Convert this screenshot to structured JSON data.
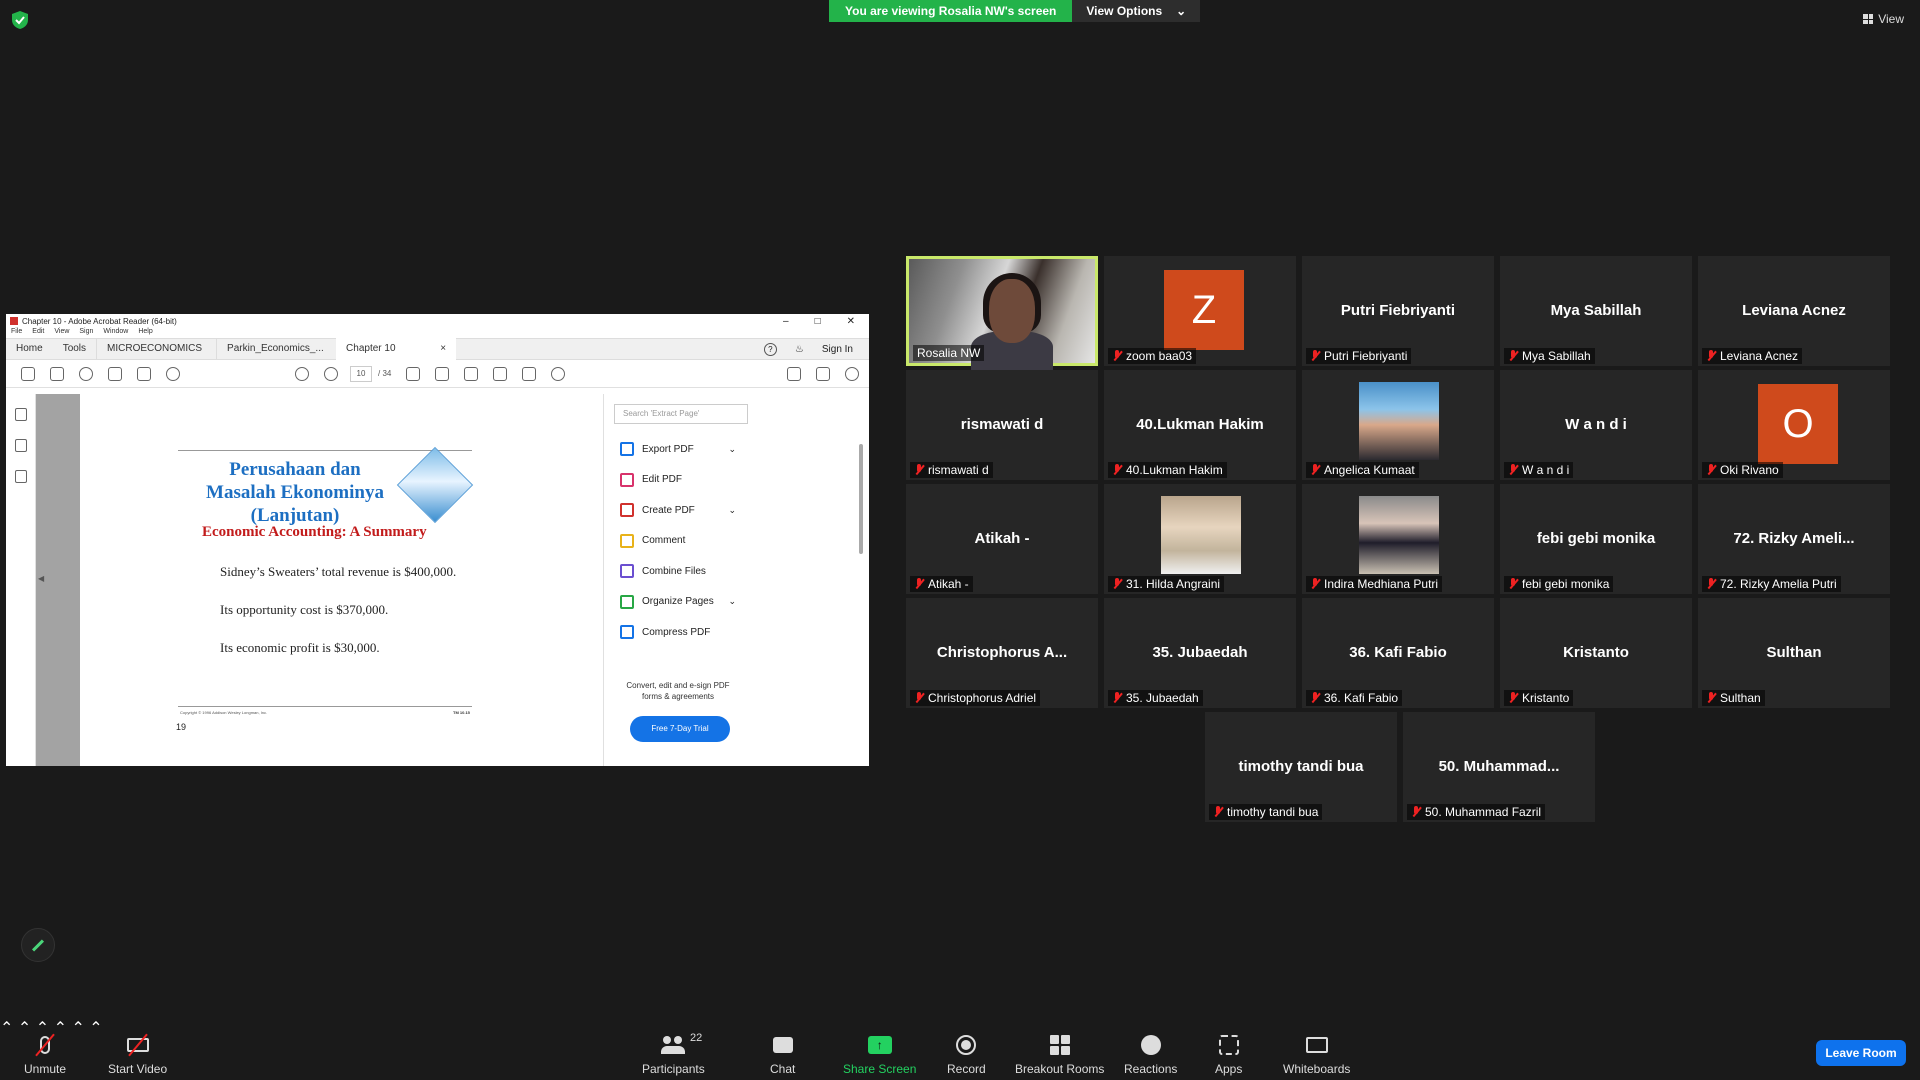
{
  "banner": {
    "viewing_text": "You are viewing Rosalia NW's screen",
    "view_options": "View Options"
  },
  "view_button": "View",
  "acrobat": {
    "title": "Chapter 10 - Adobe Acrobat Reader (64-bit)",
    "menu": [
      "File",
      "Edit",
      "View",
      "Sign",
      "Window",
      "Help"
    ],
    "tabs": {
      "home": "Home",
      "tools": "Tools",
      "doc1": "MICROECONOMICS",
      "doc2": "Parkin_Economics_...",
      "doc3": "Chapter 10"
    },
    "sign_in": "Sign In",
    "page_current": "10",
    "page_total": "/ 34",
    "page": {
      "heading": "Perusahaan dan Masalah Ekonominya (Lanjutan)",
      "subheading": "Economic Accounting:  A Summary",
      "lines": [
        "Sidney’s Sweaters’ total revenue is $400,000.",
        "Its opportunity cost is $370,000.",
        "Its economic profit is $30,000."
      ],
      "copyright": "Copyright © 1996 Addison Wesley Longman, Inc.",
      "tm": "TM 10.15",
      "page_number": "19"
    },
    "search_placeholder": "Search 'Extract Page'",
    "tools": [
      {
        "label": "Export PDF",
        "color": "#1473e6",
        "chevron": true
      },
      {
        "label": "Edit PDF",
        "color": "#d8336b",
        "chevron": false
      },
      {
        "label": "Create PDF",
        "color": "#d0312d",
        "chevron": true
      },
      {
        "label": "Comment",
        "color": "#e8b21a",
        "chevron": false
      },
      {
        "label": "Combine Files",
        "color": "#6b4fd0",
        "chevron": false
      },
      {
        "label": "Organize Pages",
        "color": "#28a745",
        "chevron": true
      },
      {
        "label": "Compress PDF",
        "color": "#1473e6",
        "chevron": false
      }
    ],
    "promo": "Convert, edit and e-sign PDF forms & agreements",
    "trial_button": "Free 7-Day Trial"
  },
  "participants": [
    {
      "big": "",
      "label": "Rosalia NW",
      "muted": false,
      "kind": "video"
    },
    {
      "big": "Z",
      "label": "zoom baa03",
      "muted": true,
      "kind": "letter"
    },
    {
      "big": "Putri Fiebriyanti",
      "label": "Putri Fiebriyanti",
      "muted": true,
      "kind": "name"
    },
    {
      "big": "Mya Sabillah",
      "label": "Mya Sabillah",
      "muted": true,
      "kind": "name"
    },
    {
      "big": "Leviana Acnez",
      "label": "Leviana Acnez",
      "muted": true,
      "kind": "name"
    },
    {
      "big": "rismawati d",
      "label": "rismawati d",
      "muted": true,
      "kind": "name"
    },
    {
      "big": "40.Lukman Hakim",
      "label": "40.Lukman Hakim",
      "muted": true,
      "kind": "name"
    },
    {
      "big": "",
      "label": "Angelica Kumaat",
      "muted": true,
      "kind": "photo1"
    },
    {
      "big": "W a n d i",
      "label": "W a n d i",
      "muted": true,
      "kind": "name"
    },
    {
      "big": "O",
      "label": "Oki Rivano",
      "muted": true,
      "kind": "letter"
    },
    {
      "big": "Atikah -",
      "label": "Atikah -",
      "muted": true,
      "kind": "name"
    },
    {
      "big": "",
      "label": "31. Hilda Angraini",
      "muted": true,
      "kind": "photo2"
    },
    {
      "big": "",
      "label": "Indira Medhiana Putri",
      "muted": true,
      "kind": "photo3"
    },
    {
      "big": "febi gebi monika",
      "label": "febi gebi monika",
      "muted": true,
      "kind": "name"
    },
    {
      "big": "72. Rizky Ameli...",
      "label": "72. Rizky Amelia Putri",
      "muted": true,
      "kind": "name"
    },
    {
      "big": "Christophorus A...",
      "label": "Christophorus Adriel",
      "muted": true,
      "kind": "name"
    },
    {
      "big": "35. Jubaedah",
      "label": "35. Jubaedah",
      "muted": true,
      "kind": "name"
    },
    {
      "big": "36. Kafi Fabio",
      "label": "36. Kafi Fabio",
      "muted": true,
      "kind": "name"
    },
    {
      "big": "Kristanto",
      "label": "Kristanto",
      "muted": true,
      "kind": "name"
    },
    {
      "big": "Sulthan",
      "label": "Sulthan",
      "muted": true,
      "kind": "name"
    },
    {
      "big": "timothy tandi bua",
      "label": "timothy tandi bua",
      "muted": true,
      "kind": "name"
    },
    {
      "big": "50.  Muhammad...",
      "label": "50. Muhammad Fazril",
      "muted": true,
      "kind": "name"
    }
  ],
  "toolbar": {
    "unmute": "Unmute",
    "start_video": "Start Video",
    "participants": "Participants",
    "participant_count": "22",
    "chat": "Chat",
    "share_screen": "Share Screen",
    "record": "Record",
    "breakout_rooms": "Breakout Rooms",
    "reactions": "Reactions",
    "apps": "Apps",
    "whiteboards": "Whiteboards",
    "leave": "Leave Room"
  },
  "colors": {
    "share_green": "#23b34a",
    "active_speaker": "#c9e86a",
    "leave_blue": "#0e72ed",
    "avatar_orange": "#cf4a1c"
  }
}
